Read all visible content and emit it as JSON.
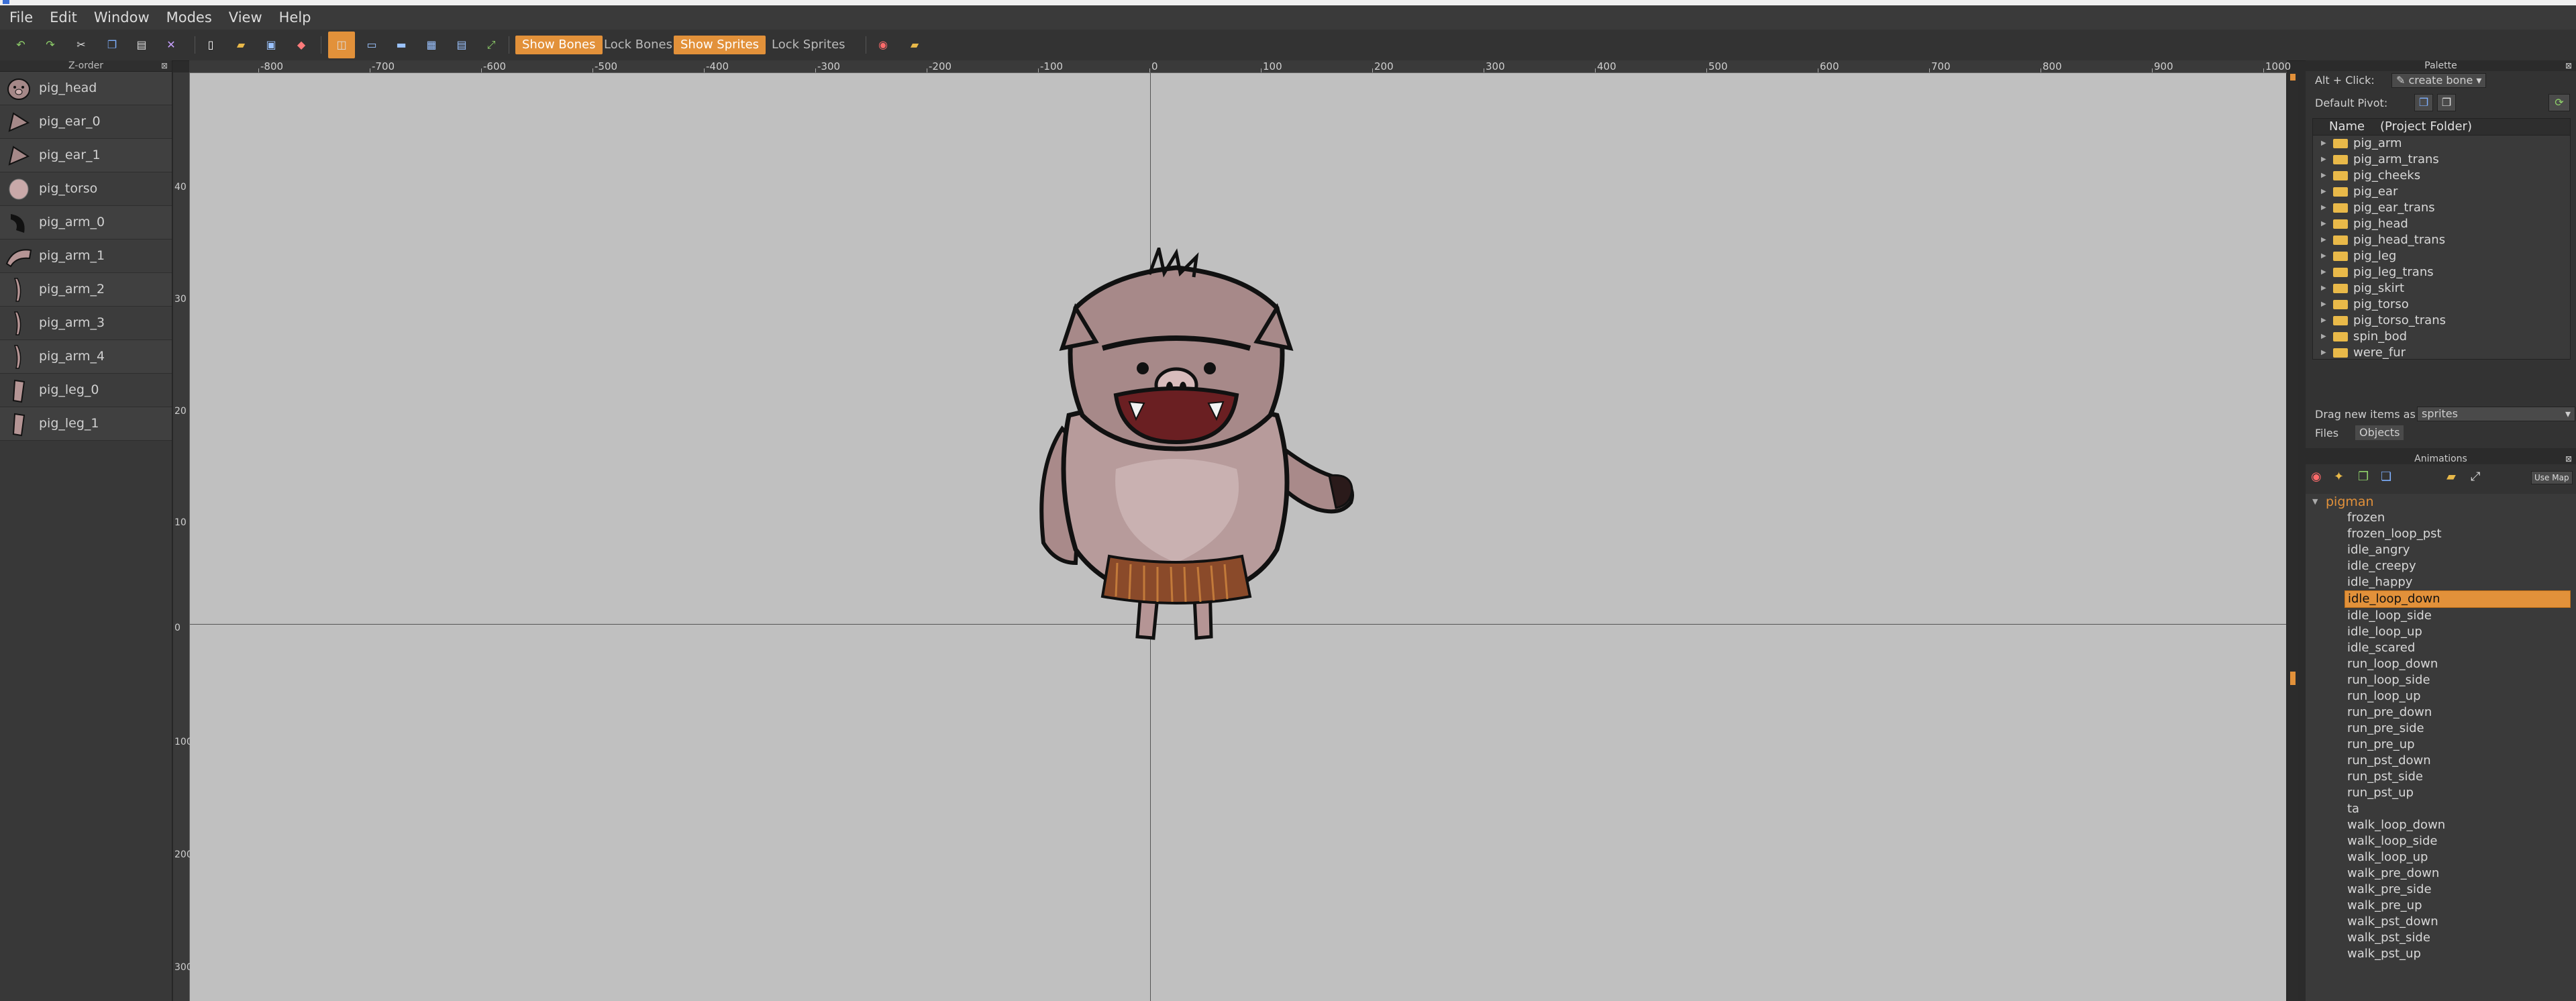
{
  "menu": [
    "File",
    "Edit",
    "Window",
    "Modes",
    "View",
    "Help"
  ],
  "toolbar": {
    "show_bones": "Show Bones",
    "lock_bones": "Lock Bones",
    "show_sprites": "Show Sprites",
    "lock_sprites": "Lock Sprites"
  },
  "zorder": {
    "title": "Z-order",
    "items": [
      "pig_head",
      "pig_ear_0",
      "pig_ear_1",
      "pig_torso",
      "pig_arm_0",
      "pig_arm_1",
      "pig_arm_2",
      "pig_arm_3",
      "pig_arm_4",
      "pig_leg_0",
      "pig_leg_1"
    ]
  },
  "ruler_top": [
    "-800",
    "-700",
    "-600",
    "-500",
    "-400",
    "-300",
    "-200",
    "-100",
    "0",
    "100",
    "200",
    "300",
    "400",
    "500",
    "600",
    "700",
    "800",
    "900",
    "1000"
  ],
  "ruler_left": [
    "40",
    "30",
    "20",
    "10",
    "0",
    "100",
    "200",
    "300"
  ],
  "palette": {
    "title": "Palette",
    "alt_click_label": "Alt + Click:",
    "alt_click_value": "create bone",
    "default_pivot_label": "Default Pivot:",
    "tree_header_name": "Name",
    "tree_header_folder": "(Project Folder)",
    "folders": [
      "pig_arm",
      "pig_arm_trans",
      "pig_cheeks",
      "pig_ear",
      "pig_ear_trans",
      "pig_head",
      "pig_head_trans",
      "pig_leg",
      "pig_leg_trans",
      "pig_skirt",
      "pig_torso",
      "pig_torso_trans",
      "spin_bod",
      "were_fur"
    ],
    "drag_label": "Drag new items as",
    "drag_value": "sprites",
    "tabs": [
      "Files",
      "Objects"
    ]
  },
  "animations": {
    "title": "Animations",
    "use_map_label": "Use Map",
    "root": "pigman",
    "items": [
      "frozen",
      "frozen_loop_pst",
      "idle_angry",
      "idle_creepy",
      "idle_happy",
      "idle_loop_down",
      "idle_loop_side",
      "idle_loop_up",
      "idle_scared",
      "run_loop_down",
      "run_loop_side",
      "run_loop_up",
      "run_pre_down",
      "run_pre_side",
      "run_pre_up",
      "run_pst_down",
      "run_pst_side",
      "run_pst_up",
      "ta",
      "walk_loop_down",
      "walk_loop_side",
      "walk_loop_up",
      "walk_pre_down",
      "walk_pre_side",
      "walk_pre_up",
      "walk_pst_down",
      "walk_pst_side",
      "walk_pst_up"
    ],
    "selected": "idle_loop_down"
  },
  "colors": {
    "accent": "#e2913a",
    "canvas": "#c0c0c0",
    "folder": "#e9b949"
  }
}
